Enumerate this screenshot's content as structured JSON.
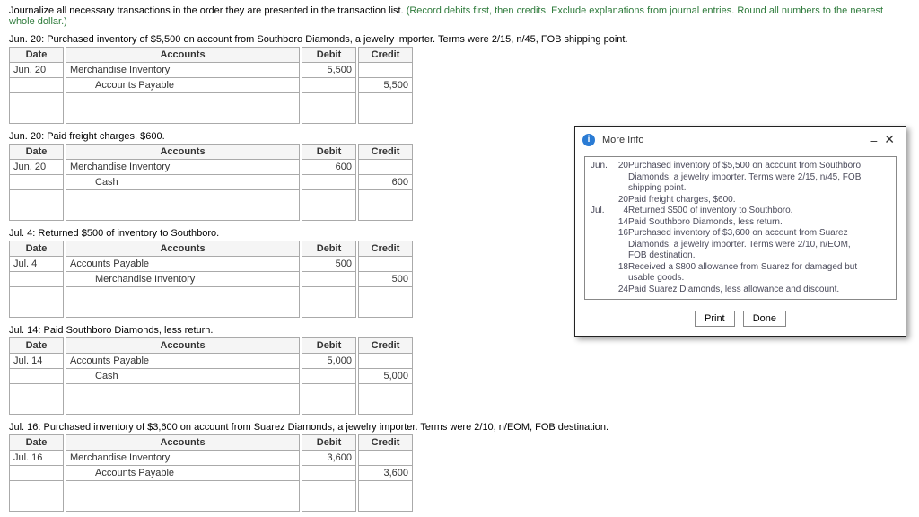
{
  "intro": {
    "black": "Journalize all necessary transactions in the order they are presented in the transaction list. ",
    "green": "(Record debits first, then credits. Exclude explanations from journal entries. Round all numbers to the nearest whole dollar.)"
  },
  "headers": {
    "date": "Date",
    "accounts": "Accounts",
    "debit": "Debit",
    "credit": "Credit"
  },
  "transactions": [
    {
      "desc": "Jun. 20: Purchased inventory of $5,500 on account from Southboro Diamonds, a jewelry importer. Terms were 2/15, n/45, FOB shipping point.",
      "date": "Jun. 20",
      "rows": [
        {
          "acct": "Merchandise Inventory",
          "debit": "5,500",
          "credit": "",
          "indent": false
        },
        {
          "acct": "Accounts Payable",
          "debit": "",
          "credit": "5,500",
          "indent": true
        }
      ]
    },
    {
      "desc": "Jun. 20: Paid freight charges, $600.",
      "date": "Jun. 20",
      "rows": [
        {
          "acct": "Merchandise Inventory",
          "debit": "600",
          "credit": "",
          "indent": false
        },
        {
          "acct": "Cash",
          "debit": "",
          "credit": "600",
          "indent": true
        }
      ]
    },
    {
      "desc": "Jul. 4: Returned $500 of inventory to Southboro.",
      "date": "Jul. 4",
      "rows": [
        {
          "acct": "Accounts Payable",
          "debit": "500",
          "credit": "",
          "indent": false
        },
        {
          "acct": "Merchandise Inventory",
          "debit": "",
          "credit": "500",
          "indent": true
        }
      ]
    },
    {
      "desc": "Jul. 14: Paid Southboro Diamonds, less return.",
      "date": "Jul. 14",
      "rows": [
        {
          "acct": "Accounts Payable",
          "debit": "5,000",
          "credit": "",
          "indent": false
        },
        {
          "acct": "Cash",
          "debit": "",
          "credit": "5,000",
          "indent": true
        }
      ]
    },
    {
      "desc": "Jul. 16: Purchased inventory of $3,600 on account from Suarez Diamonds, a jewelry importer. Terms were 2/10, n/EOM, FOB destination.",
      "date": "Jul. 16",
      "rows": [
        {
          "acct": "Merchandise Inventory",
          "debit": "3,600",
          "credit": "",
          "indent": false
        },
        {
          "acct": "Accounts Payable",
          "debit": "",
          "credit": "3,600",
          "indent": true
        }
      ]
    }
  ],
  "dialog": {
    "title": "More Info",
    "info_glyph": "i",
    "minimize": "–",
    "close": "✕",
    "events": [
      {
        "mon": "Jun.",
        "day": "20",
        "text": "Purchased inventory of $5,500 on account from Southboro Diamonds, a jewelry importer. Terms were 2/15, n/45, FOB shipping point."
      },
      {
        "mon": "",
        "day": "20",
        "text": "Paid freight charges, $600."
      },
      {
        "mon": "Jul.",
        "day": "4",
        "text": "Returned $500 of inventory to Southboro."
      },
      {
        "mon": "",
        "day": "14",
        "text": "Paid Southboro Diamonds, less return."
      },
      {
        "mon": "",
        "day": "16",
        "text": "Purchased inventory of $3,600 on account from Suarez Diamonds, a jewelry importer. Terms were 2/10, n/EOM, FOB destination."
      },
      {
        "mon": "",
        "day": "18",
        "text": "Received a $800 allowance from Suarez for damaged but usable goods."
      },
      {
        "mon": "",
        "day": "24",
        "text": "Paid Suarez Diamonds, less allowance and discount."
      }
    ],
    "print": "Print",
    "done": "Done"
  }
}
